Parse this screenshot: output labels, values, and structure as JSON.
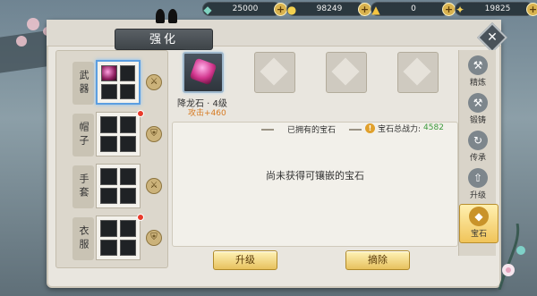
{
  "resources": [
    {
      "icon": "jade-icon",
      "value": "25000"
    },
    {
      "icon": "gold-ingot-icon",
      "value": "98249"
    },
    {
      "icon": "yuanbao-icon",
      "value": "0"
    },
    {
      "icon": "coin-icon",
      "value": "19825"
    }
  ],
  "title": "强化",
  "equipment": [
    {
      "label": "武器",
      "selected": true
    },
    {
      "label": "帽子",
      "selected": false
    },
    {
      "label": "手套",
      "selected": false
    },
    {
      "label": "衣服",
      "selected": false
    }
  ],
  "gem": {
    "name": "降龙石 · 4级",
    "bonus": "攻击+460"
  },
  "owned_label": "已拥有的宝石",
  "power_label": "宝石总战力:",
  "power_value": "4582",
  "empty_text": "尚未获得可镶嵌的宝石",
  "buttons": {
    "upgrade": "升级",
    "remove": "摘除"
  },
  "tabs": [
    {
      "label": "精炼"
    },
    {
      "label": "锻铸"
    },
    {
      "label": "传承"
    },
    {
      "label": "升级"
    },
    {
      "label": "宝石"
    }
  ],
  "colors": {
    "power_value": "#3d9a3d",
    "bonus": "#d77a21",
    "button": "#e7c15e"
  }
}
